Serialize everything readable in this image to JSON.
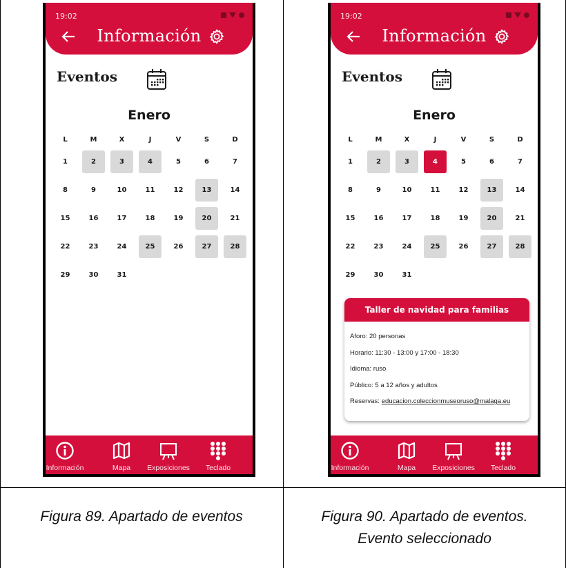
{
  "figures": [
    {
      "caption": "Figura 89. Apartado de eventos",
      "screen": {
        "status_time": "19:02",
        "appbar_title": "Información",
        "section_title": "Eventos",
        "month": "Enero",
        "weekdays": [
          "L",
          "M",
          "X",
          "J",
          "V",
          "S",
          "D"
        ],
        "weeks": [
          [
            "1",
            "2",
            "3",
            "4",
            "5",
            "6",
            "7"
          ],
          [
            "8",
            "9",
            "10",
            "11",
            "12",
            "13",
            "14"
          ],
          [
            "15",
            "16",
            "17",
            "18",
            "19",
            "20",
            "21"
          ],
          [
            "22",
            "23",
            "24",
            "25",
            "26",
            "27",
            "28"
          ],
          [
            "29",
            "30",
            "31",
            "",
            "",
            "",
            ""
          ]
        ],
        "event_days": [
          "2",
          "3",
          "4",
          "13",
          "20",
          "25",
          "27",
          "28"
        ],
        "selected_day": "",
        "nav": [
          {
            "label": "Información",
            "icon": "info-icon"
          },
          {
            "label": "Mapa",
            "icon": "map-icon"
          },
          {
            "label": "Exposiciones",
            "icon": "easel-icon"
          },
          {
            "label": "Teclado",
            "icon": "keypad-icon"
          }
        ]
      }
    },
    {
      "caption": "Figura 90. Apartado de eventos. Evento seleccionado",
      "screen": {
        "status_time": "19:02",
        "appbar_title": "Información",
        "section_title": "Eventos",
        "month": "Enero",
        "weekdays": [
          "L",
          "M",
          "X",
          "J",
          "V",
          "S",
          "D"
        ],
        "weeks": [
          [
            "1",
            "2",
            "3",
            "4",
            "5",
            "6",
            "7"
          ],
          [
            "8",
            "9",
            "10",
            "11",
            "12",
            "13",
            "14"
          ],
          [
            "15",
            "16",
            "17",
            "18",
            "19",
            "20",
            "21"
          ],
          [
            "22",
            "23",
            "24",
            "25",
            "26",
            "27",
            "28"
          ],
          [
            "29",
            "30",
            "31",
            "",
            "",
            "",
            ""
          ]
        ],
        "event_days": [
          "2",
          "3",
          "4",
          "13",
          "20",
          "25",
          "27",
          "28"
        ],
        "selected_day": "4",
        "event": {
          "title": "Taller de navidad para familias",
          "aforo": "Aforo: 20 personas",
          "horario": "Horario: 11:30 - 13:00 y 17:00 - 18:30",
          "idioma": "Idioma: ruso",
          "publico": "Público: 5 a 12 años y adultos",
          "reservas_label": "Reservas:",
          "reservas_email": "educacion.coleccionmuseoruso@malaga.eu"
        },
        "nav": [
          {
            "label": "Información",
            "icon": "info-icon"
          },
          {
            "label": "Mapa",
            "icon": "map-icon"
          },
          {
            "label": "Exposiciones",
            "icon": "easel-icon"
          },
          {
            "label": "Teclado",
            "icon": "keypad-icon"
          }
        ]
      }
    }
  ],
  "colors": {
    "brand_red": "#d50f3c",
    "event_day_gray": "#d9d9d9"
  }
}
